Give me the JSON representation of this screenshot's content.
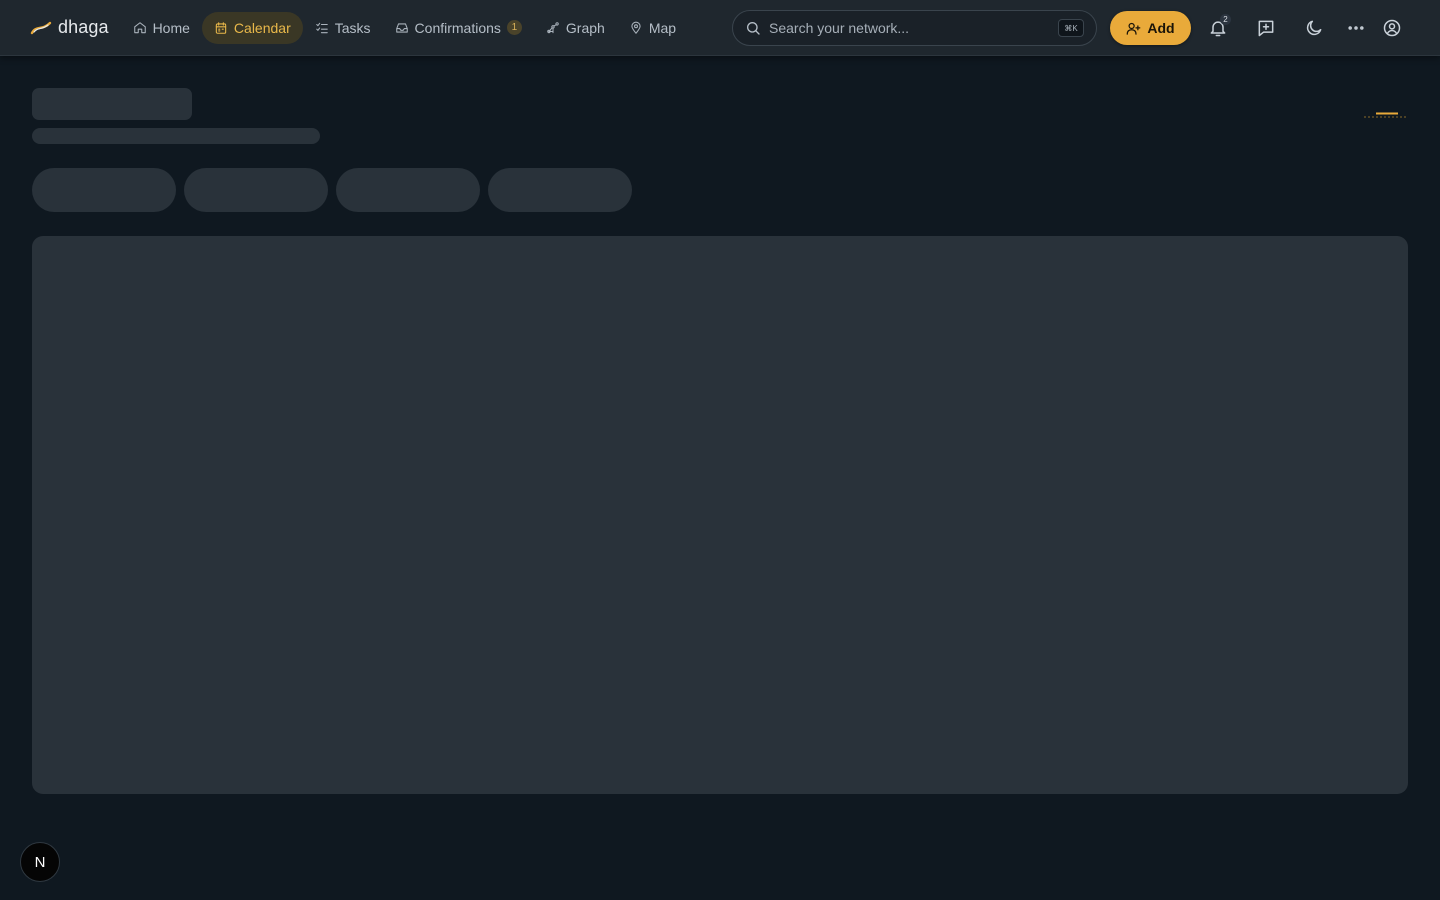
{
  "brand": {
    "name": "dhaga",
    "accent": "#e9aa3a"
  },
  "nav": [
    {
      "label": "Home",
      "icon": "home-icon",
      "active": false
    },
    {
      "label": "Calendar",
      "icon": "calendar-icon",
      "active": true
    },
    {
      "label": "Tasks",
      "icon": "tasks-icon",
      "active": false
    },
    {
      "label": "Confirmations",
      "icon": "inbox-icon",
      "active": false,
      "badge": "1"
    },
    {
      "label": "Graph",
      "icon": "graph-icon",
      "active": false
    },
    {
      "label": "Map",
      "icon": "map-pin-icon",
      "active": false
    }
  ],
  "search": {
    "placeholder": "Search your network...",
    "shortcut": "⌘K"
  },
  "actions": {
    "add_label": "Add",
    "notification_count": "2"
  },
  "dev": {
    "indicator_label": "N"
  },
  "colors": {
    "background": "#0f1820",
    "topbar": "#1f272e",
    "skeleton": "#29323a",
    "active_nav": "#3a3725"
  }
}
